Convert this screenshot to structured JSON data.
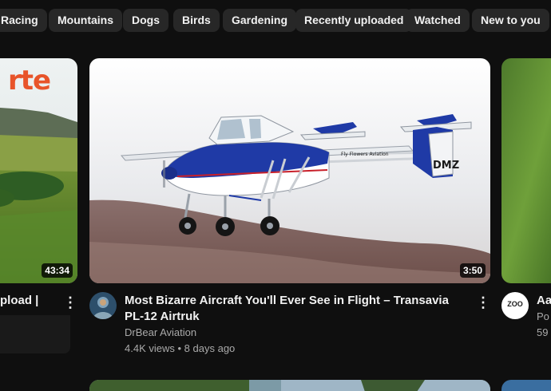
{
  "chips": [
    "Racing",
    "Mountains",
    "Dogs",
    "Birds",
    "Gardening",
    "Recently uploaded",
    "Watched",
    "New to you"
  ],
  "left_video": {
    "thumb_text": "rte",
    "duration": "43:34",
    "title_fragment": "pload |"
  },
  "main_video": {
    "duration": "3:50",
    "title": "Most Bizarre Aircraft You'll Ever See in Flight – Transavia PL-12 Airtruk",
    "channel": "DrBear Aviation",
    "views": "4.4K views",
    "age": "8 days ago",
    "tail_marking": "DMZ",
    "fuselage_text": "Fly Flowers Aviation"
  },
  "right_video": {
    "avatar_text": "ZOO",
    "title_fragment": "Aa",
    "channel_fragment": "Po",
    "meta_fragment": "59"
  },
  "icons": {
    "kebab": "more-vert-icon"
  }
}
